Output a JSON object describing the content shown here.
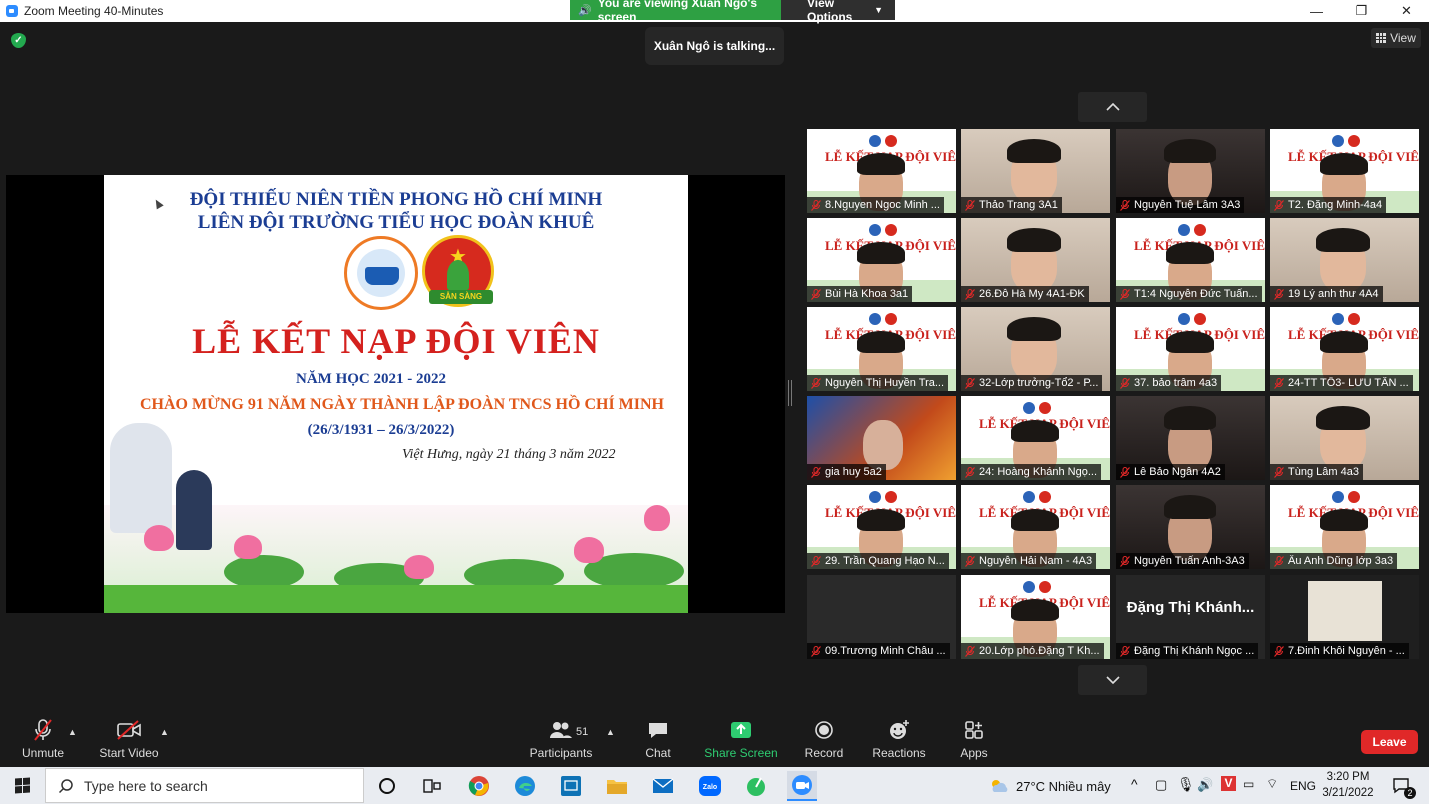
{
  "window": {
    "title": "Zoom Meeting 40-Minutes",
    "controls": [
      "—",
      "❐",
      "✕"
    ]
  },
  "banner": {
    "viewing": "You are viewing Xuân Ngô's screen",
    "view_options": "View Options"
  },
  "talking": "Xuân Ngô is talking...",
  "view_button": "View",
  "slide": {
    "line1": "ĐỘI THIẾU NIÊN TIỀN PHONG HỒ CHÍ MINH",
    "line2": "LIÊN ĐỘI TRƯỜNG TIỂU HỌC ĐOÀN KHUÊ",
    "badge_text": "SẴN SÀNG",
    "title": "LỄ KẾT NẠP ĐỘI VIÊN",
    "school_year": "NĂM HỌC 2021 - 2022",
    "congrats": "CHÀO MỪNG 91 NĂM NGÀY THÀNH LẬP ĐOÀN TNCS HỒ CHÍ MINH",
    "dates": "(26/3/1931 – 26/3/2022)",
    "place_date": "Việt Hưng, ngày 21 tháng 3 năm 2022"
  },
  "gallery": {
    "participants": [
      "8.Nguyen Ngoc Minh ...",
      "Thảo Trang 3A1",
      "Nguyễn Tuệ Lâm 3A3",
      "T2. Đặng Minh-4a4",
      "Bùi Hà Khoa 3a1",
      "26.Đỗ Hà My 4A1-ĐK",
      "T1:4 Nguyễn Đức Tuấn...",
      "19 Lý anh thư 4A4",
      "Nguyễn Thị Huyền Tra...",
      "32-Lớp trưởng-Tổ2 - P...",
      "37. bảo trâm 4a3",
      "24-TT TỔ3- LƯU TẤN ...",
      "gia huy 5a2",
      "24: Hoàng Khánh Ngọ...",
      "Lê Bảo Ngân 4A2",
      "Tùng Lâm 4a3",
      "29. Trần Quang Hạo N...",
      "Nguyễn Hải Nam - 4A3",
      "Nguyễn Tuấn Anh-3A3",
      "Âu Anh Dũng lớp 3a3",
      "09.Trương Minh Châu ...",
      "20.Lớp phó.Đặng T Kh...",
      "Đặng Thị Khánh Ngọc ...",
      "7.Đinh Khôi Nguyên - ..."
    ],
    "tile_slide_title": "LỄ KẾT NẠP ĐỘI VIÊN",
    "big_name": "Đặng Thị Khánh..."
  },
  "toolbar": {
    "unmute": "Unmute",
    "start_video": "Start Video",
    "participants": "Participants",
    "participant_count": "51",
    "chat": "Chat",
    "share_screen": "Share Screen",
    "record": "Record",
    "reactions": "Reactions",
    "apps": "Apps",
    "leave": "Leave"
  },
  "taskbar": {
    "search_placeholder": "Type here to search",
    "weather": "27°C  Nhiều mây",
    "language": "ENG",
    "time": "3:20 PM",
    "date": "3/21/2022",
    "notification_count": "2"
  },
  "colors": {
    "accent_green": "#2ea043",
    "leave_red": "#e02828",
    "share_green": "#2ecc71",
    "slide_red": "#d4211e",
    "slide_blue": "#1b3d93"
  }
}
